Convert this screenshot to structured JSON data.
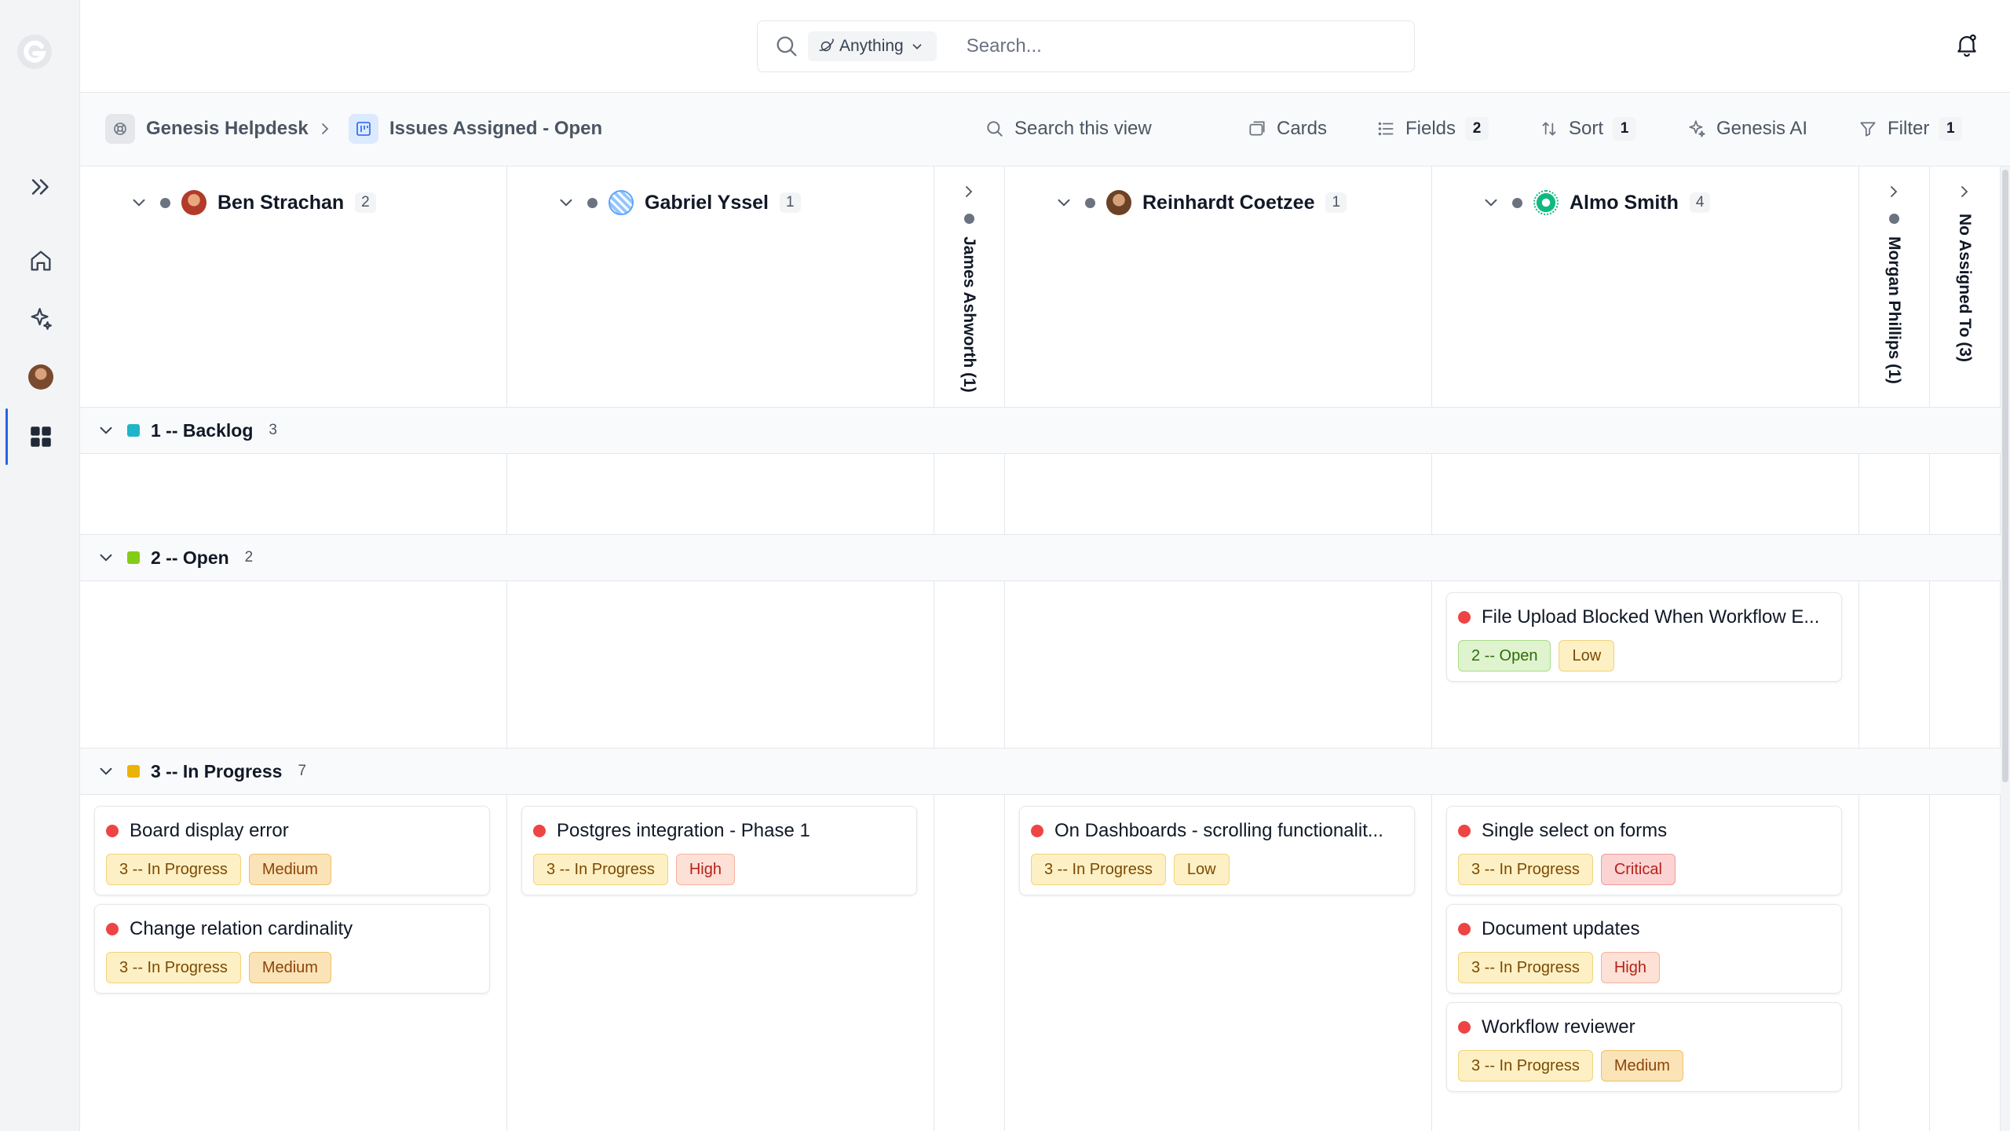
{
  "topbar": {
    "scope_label": "Anything",
    "search_placeholder": "Search..."
  },
  "breadcrumb": {
    "workspace": "Genesis Helpdesk",
    "view": "Issues Assigned - Open"
  },
  "toolbar": {
    "search_view": "Search this view",
    "cards": "Cards",
    "fields": "Fields",
    "fields_count": "2",
    "sort": "Sort",
    "sort_count": "1",
    "ai": "Genesis AI",
    "filter": "Filter",
    "filter_count": "1"
  },
  "columns": [
    {
      "name": "Ben Strachan",
      "count": "2"
    },
    {
      "name": "Gabriel Yssel",
      "count": "1"
    },
    {
      "name": "James Ashworth (1)",
      "collapsed": true
    },
    {
      "name": "Reinhardt Coetzee",
      "count": "1"
    },
    {
      "name": "Almo Smith",
      "count": "4"
    },
    {
      "name": "Morgan Phillips (1)",
      "collapsed": true
    },
    {
      "name": "No Assigned To (3)",
      "collapsed": true
    }
  ],
  "groups": [
    {
      "label": "1 -- Backlog",
      "count": "3",
      "color": "#1fb5c9"
    },
    {
      "label": "2 -- Open",
      "count": "2",
      "color": "#84cc16"
    },
    {
      "label": "3 -- In Progress",
      "count": "7",
      "color": "#eab308"
    }
  ],
  "cards": {
    "open_almo_1": {
      "title": "File Upload Blocked When Workflow E...",
      "status": "2 -- Open",
      "priority": "Low"
    },
    "prog_ben_1": {
      "title": "Board display error",
      "status": "3 -- In Progress",
      "priority": "Medium"
    },
    "prog_ben_2": {
      "title": "Change relation cardinality",
      "status": "3 -- In Progress",
      "priority": "Medium"
    },
    "prog_gabriel_1": {
      "title": "Postgres integration - Phase 1",
      "status": "3 -- In Progress",
      "priority": "High"
    },
    "prog_reinhardt_1": {
      "title": "On Dashboards - scrolling functionalit...",
      "status": "3 -- In Progress",
      "priority": "Low"
    },
    "prog_almo_1": {
      "title": "Single select on forms",
      "status": "3 -- In Progress",
      "priority": "Critical"
    },
    "prog_almo_2": {
      "title": "Document updates",
      "status": "3 -- In Progress",
      "priority": "High"
    },
    "prog_almo_3": {
      "title": "Workflow reviewer",
      "status": "3 -- In Progress",
      "priority": "Medium"
    }
  },
  "icons": {
    "rail": [
      "genesis-logo-icon",
      "expand-icon",
      "home-icon",
      "sparkle-icon",
      "user-avatar",
      "apps-grid-icon"
    ],
    "topbar": [
      "search-icon",
      "planet-icon",
      "chevron-down-icon",
      "bell-icon"
    ]
  },
  "colors": {
    "accent": "#2563eb",
    "priority_dot": "#ef4444"
  }
}
